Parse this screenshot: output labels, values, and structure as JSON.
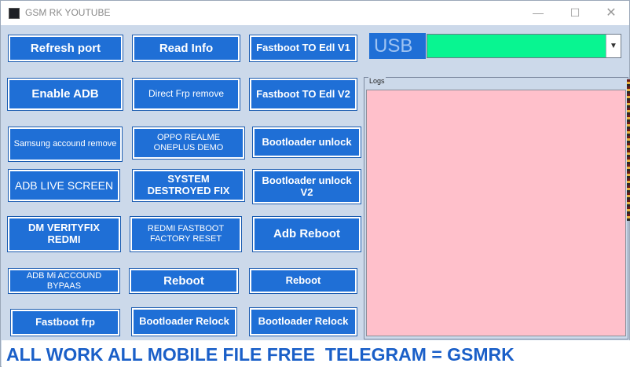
{
  "window": {
    "title": "GSM RK YOUTUBE",
    "minimize": "—",
    "maximize": "☐",
    "close": "✕"
  },
  "buttons": {
    "refresh_port": "Refresh port",
    "read_info": "Read Info",
    "fastboot_to_edl_v1": "Fastboot TO Edl V1",
    "enable_adb": "Enable ADB",
    "direct_frp_remove": "Direct Frp remove",
    "fastboot_to_edl_v2": "Fastboot TO Edl V2",
    "samsung_account_remove": "Samsung accound remove",
    "oppo_realme_oneplus_demo": "OPPO REALME ONEPLUS DEMO",
    "bootloader_unlock": "Bootloader unlock",
    "adb_live_screen": "ADB LIVE SCREEN",
    "system_destroyed_fix": "SYSTEM DESTROYED FIX",
    "bootloader_unlock_v2": "Bootloader unlock V2",
    "dm_verityfix_redmi": "DM VERITYFIX REDMI",
    "redmi_fastboot_factory_reset": "REDMI FASTBOOT FACTORY RESET",
    "adb_reboot": "Adb Reboot",
    "adb_mi_account_bypass": "ADB Mi ACCOUND BYPAAS",
    "reboot_1": "Reboot",
    "reboot_2": "Reboot",
    "fastboot_frp": "Fastboot frp",
    "bootloader_relock_1": "Bootloader Relock",
    "bootloader_relock_2": "Bootloader Relock"
  },
  "usb": {
    "label": "USB",
    "selected": ""
  },
  "logs": {
    "label": "Logs",
    "content": ""
  },
  "marquee": "ALL WORK ALL MOBILE FILE FREE  TELEGRAM = GSMRK",
  "colors": {
    "button_blue": "#1f6fd6",
    "window_bg": "#ccd9ea",
    "usb_select_green": "#08f591",
    "logs_pink": "#ffc0cb",
    "marquee_text": "#1a5fc8"
  }
}
